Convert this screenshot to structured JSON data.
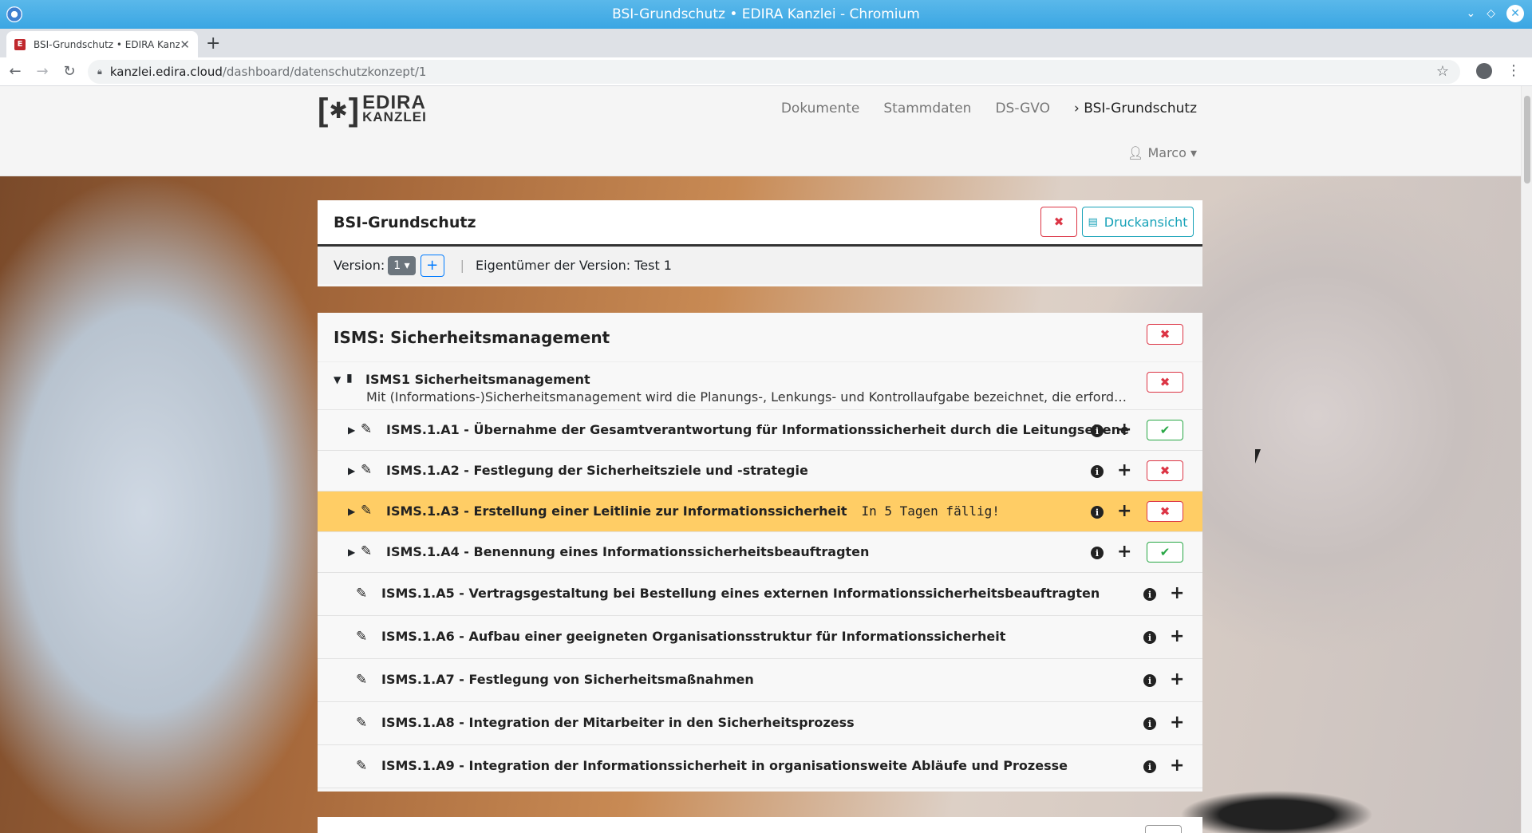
{
  "os": {
    "window_title": "BSI-Grundschutz • EDIRA Kanzlei - Chromium"
  },
  "browser": {
    "tab_title": "BSI-Grundschutz • EDIRA Kanzlei",
    "url_host": "kanzlei.edira.cloud",
    "url_path": "/dashboard/datenschutzkonzept/1"
  },
  "header": {
    "logo_line1": "EDIRA",
    "logo_line2": "KANZLEI",
    "nav": [
      "Dokumente",
      "Stammdaten",
      "DS-GVO",
      "BSI-Grundschutz"
    ],
    "active_nav_prefix": "›",
    "user": "Marco"
  },
  "page": {
    "title": "BSI-Grundschutz",
    "print_label": "Druckansicht",
    "version_label": "Version:",
    "version_value": "1",
    "owner_text": "Eigentümer der Version: Test 1"
  },
  "isms": {
    "title": "ISMS: Sicherheitsmanagement",
    "group_title": "ISMS1 Sicherheitsmanagement",
    "group_desc": "Mit (Informations-)Sicherheitsmanagement wird die Planungs-, Lenkungs- und Kontrollaufgabe bezeichnet, die erforderlich ist, um ein...",
    "requirements": [
      {
        "title": "ISMS.1.A1 - Übernahme der Gesamtverantwortung für Informationssicherheit durch die Leitungsebene",
        "status": "done",
        "due": ""
      },
      {
        "title": "ISMS.1.A2 - Festlegung der Sicherheitsziele und -strategie",
        "status": "open",
        "due": ""
      },
      {
        "title": "ISMS.1.A3 - Erstellung einer Leitlinie zur Informationssicherheit",
        "status": "open",
        "due": "In 5 Tagen fällig!"
      },
      {
        "title": "ISMS.1.A4 - Benennung eines Informationssicherheitsbeauftragten",
        "status": "done",
        "due": ""
      },
      {
        "title": "ISMS.1.A5 - Vertragsgestaltung bei Bestellung eines externen Informationssicherheitsbeauftragten",
        "status": "none",
        "due": ""
      },
      {
        "title": "ISMS.1.A6 - Aufbau einer geeigneten Organisationsstruktur für Informationssicherheit",
        "status": "none",
        "due": ""
      },
      {
        "title": "ISMS.1.A7 - Festlegung von Sicherheitsmaßnahmen",
        "status": "none",
        "due": ""
      },
      {
        "title": "ISMS.1.A8 - Integration der Mitarbeiter in den Sicherheitsprozess",
        "status": "none",
        "due": ""
      },
      {
        "title": "ISMS.1.A9 - Integration der Informationssicherheit in organisationsweite Abläufe und Prozesse",
        "status": "none",
        "due": ""
      }
    ]
  },
  "icons": {
    "close_x": "✕",
    "reload": "↻",
    "back": "←",
    "forward": "→",
    "star": "☆",
    "tools_x": "✖",
    "check": "✔",
    "info": "i",
    "plus": "+",
    "edit": "✎",
    "caret_right": "▸",
    "caret_down": "▾",
    "book": "▮"
  },
  "colors": {
    "warning_row": "#ffcd65",
    "danger": "#dc3545",
    "success": "#28a745",
    "info": "#17a2b8"
  }
}
